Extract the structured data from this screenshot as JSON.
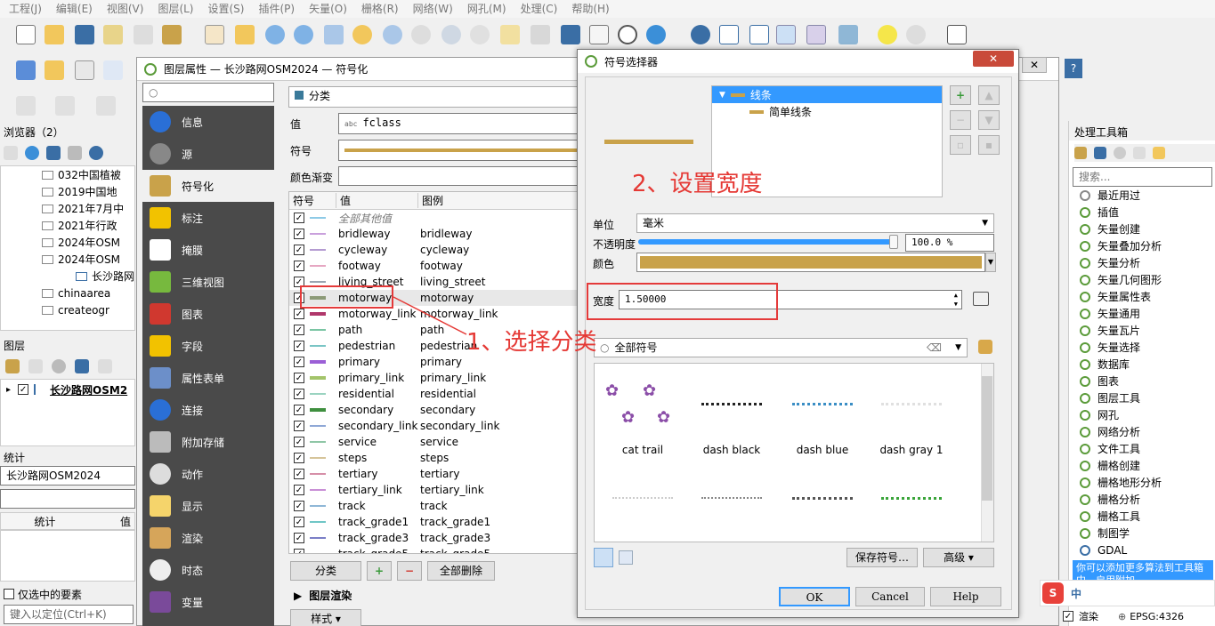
{
  "menubar": {
    "items": [
      "工程(J)",
      "编辑(E)",
      "视图(V)",
      "图层(L)",
      "设置(S)",
      "插件(P)",
      "矢量(O)",
      "栅格(R)",
      "网络(W)",
      "网孔(M)",
      "处理(C)",
      "帮助(H)"
    ]
  },
  "browser": {
    "title": "浏览器（2）",
    "items": [
      "032中国植被",
      "2019中国地",
      "2021年7月中",
      "2021年行政",
      "2024年OSM",
      "2024年OSM",
      "长沙路网",
      "chinaarea",
      "createogr"
    ]
  },
  "layers": {
    "title": "图层",
    "layer_name": "长沙路网OSM2"
  },
  "stats": {
    "title": "统计",
    "layer": "长沙路网OSM2024",
    "col_stat": "统计",
    "col_value": "值",
    "selected_only": "仅选中的要素",
    "locate_placeholder": "键入以定位(Ctrl+K)"
  },
  "layer_dialog": {
    "title": "图层属性 — 长沙路网OSM2024 — 符号化",
    "nav": [
      {
        "label": "信息",
        "color": "#2a6fd6"
      },
      {
        "label": "源",
        "color": "#888888"
      },
      {
        "label": "符号化",
        "color": "#c9a24a"
      },
      {
        "label": "标注",
        "color": "#f2c200"
      },
      {
        "label": "掩膜",
        "color": "#ffffff"
      },
      {
        "label": "三维视图",
        "color": "#77b93e"
      },
      {
        "label": "图表",
        "color": "#d0382f"
      },
      {
        "label": "字段",
        "color": "#f2c200"
      },
      {
        "label": "属性表单",
        "color": "#6c8fc9"
      },
      {
        "label": "连接",
        "color": "#2a6fd6"
      },
      {
        "label": "附加存储",
        "color": "#bbbbbb"
      },
      {
        "label": "动作",
        "color": "#dddddd"
      },
      {
        "label": "显示",
        "color": "#f5d46b"
      },
      {
        "label": "渲染",
        "color": "#d6a55a"
      },
      {
        "label": "时态",
        "color": "#eeeeee"
      },
      {
        "label": "变量",
        "color": "#7a4a9a"
      }
    ],
    "renderer": "分类",
    "value_label": "值",
    "value": "fclass",
    "symbol_label": "符号",
    "ramp_label": "颜色渐变",
    "col_symbol": "符号",
    "col_value": "值",
    "col_legend": "图例",
    "rows": [
      {
        "value": "全部其他值",
        "legend": "",
        "color": "#8ecae6",
        "italic": true
      },
      {
        "value": "bridleway",
        "legend": "bridleway",
        "color": "#c9a0dc"
      },
      {
        "value": "cycleway",
        "legend": "cycleway",
        "color": "#b49bd1"
      },
      {
        "value": "footway",
        "legend": "footway",
        "color": "#e6a7c2"
      },
      {
        "value": "living_street",
        "legend": "living_street",
        "color": "#9aa5b1"
      },
      {
        "value": "motorway",
        "legend": "motorway",
        "color": "#8c9a77",
        "thick": true
      },
      {
        "value": "motorway_link",
        "legend": "motorway_link",
        "color": "#b0376b",
        "thick": true
      },
      {
        "value": "path",
        "legend": "path",
        "color": "#7ac5a3"
      },
      {
        "value": "pedestrian",
        "legend": "pedestrian",
        "color": "#7ac5c5"
      },
      {
        "value": "primary",
        "legend": "primary",
        "color": "#9b5fd6",
        "thick": true
      },
      {
        "value": "primary_link",
        "legend": "primary_link",
        "color": "#a3c46a",
        "thick": true
      },
      {
        "value": "residential",
        "legend": "residential",
        "color": "#9ad3c0"
      },
      {
        "value": "secondary",
        "legend": "secondary",
        "color": "#3f8f3f",
        "thick": true
      },
      {
        "value": "secondary_link",
        "legend": "secondary_link",
        "color": "#8fa8d6"
      },
      {
        "value": "service",
        "legend": "service",
        "color": "#8fc6a6"
      },
      {
        "value": "steps",
        "legend": "steps",
        "color": "#d6c49a"
      },
      {
        "value": "tertiary",
        "legend": "tertiary",
        "color": "#d68fa8"
      },
      {
        "value": "tertiary_link",
        "legend": "tertiary_link",
        "color": "#c98fd6"
      },
      {
        "value": "track",
        "legend": "track",
        "color": "#8fb7d6"
      },
      {
        "value": "track_grade1",
        "legend": "track_grade1",
        "color": "#6fc6c6"
      },
      {
        "value": "track_grade3",
        "legend": "track_grade3",
        "color": "#7a7fc6"
      },
      {
        "value": "track_grade5",
        "legend": "track_grade5",
        "color": "#a6c66f"
      }
    ],
    "btn_classify": "分类",
    "btn_delete_all": "全部删除",
    "layer_rendering": "图层渲染",
    "style_btn": "样式"
  },
  "symbol_dialog": {
    "title": "符号选择器",
    "tree_line": "线条",
    "tree_simple": "简单线条",
    "unit_label": "单位",
    "unit_value": "毫米",
    "opacity_label": "不透明度",
    "opacity_value": "100.0 %",
    "opacity_fraction": 1.0,
    "color_label": "颜色",
    "color_value": "#c9a24a",
    "width_label": "宽度",
    "width_value": "1.50000",
    "search_value": "全部符号",
    "gallery": [
      "cat trail",
      "dash  black",
      "dash blue",
      "dash gray 1"
    ],
    "btn_save": "保存符号…",
    "btn_advanced": "高级",
    "btn_ok": "OK",
    "btn_cancel": "Cancel",
    "btn_help": "Help"
  },
  "annotations": {
    "step1": "1、选择分类",
    "step2": "2、设置宽度"
  },
  "toolbox": {
    "title": "处理工具箱",
    "search_placeholder": "搜索...",
    "items": [
      "最近用过",
      "插值",
      "矢量创建",
      "矢量叠加分析",
      "矢量分析",
      "矢量几何图形",
      "矢量属性表",
      "矢量通用",
      "矢量瓦片",
      "矢量选择",
      "数据库",
      "图表",
      "图层工具",
      "网孔",
      "网络分析",
      "文件工具",
      "栅格创建",
      "栅格地形分析",
      "栅格分析",
      "栅格工具",
      "制图学",
      "GDAL"
    ],
    "hint": "你可以添加更多算法到工具箱中，",
    "hint_link": "启用附加"
  },
  "statusbar": {
    "render": "渲染",
    "crs": "EPSG:4326"
  },
  "colors": {
    "accent": "#3399ff",
    "annotation": "#e53935",
    "nav_bg": "#4a4a4a"
  }
}
